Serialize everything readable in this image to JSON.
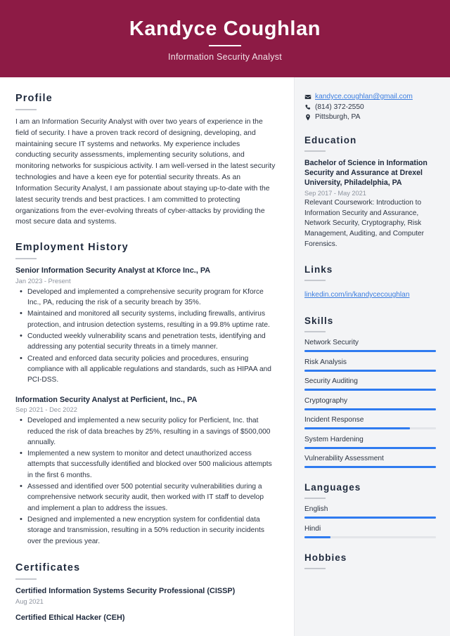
{
  "header": {
    "name": "Kandyce Coughlan",
    "job_title": "Information Security Analyst",
    "background_color": "#8d1b45"
  },
  "accent": {
    "bar_color": "#2f7bf0",
    "link_color": "#3b7de0",
    "sidebar_bg": "#f3f4f6"
  },
  "main": {
    "profile": {
      "heading": "Profile",
      "text": "I am an Information Security Analyst with over two years of experience in the field of security. I have a proven track record of designing, developing, and maintaining secure IT systems and networks. My experience includes conducting security assessments, implementing security solutions, and monitoring networks for suspicious activity. I am well-versed in the latest security technologies and have a keen eye for potential security threats. As an Information Security Analyst, I am passionate about staying up-to-date with the latest security trends and best practices. I am committed to protecting organizations from the ever-evolving threats of cyber-attacks by providing the most secure data and systems."
    },
    "employment": {
      "heading": "Employment History",
      "jobs": [
        {
          "title": "Senior Information Security Analyst at Kforce Inc., PA",
          "date": "Jan 2023 - Present",
          "bullets": [
            "Developed and implemented a comprehensive security program for Kforce Inc., PA, reducing the risk of a security breach by 35%.",
            "Maintained and monitored all security systems, including firewalls, antivirus protection, and intrusion detection systems, resulting in a 99.8% uptime rate.",
            "Conducted weekly vulnerability scans and penetration tests, identifying and addressing any potential security threats in a timely manner.",
            "Created and enforced data security policies and procedures, ensuring compliance with all applicable regulations and standards, such as HIPAA and PCI-DSS."
          ]
        },
        {
          "title": "Information Security Analyst at Perficient, Inc., PA",
          "date": "Sep 2021 - Dec 2022",
          "bullets": [
            "Developed and implemented a new security policy for Perficient, Inc. that reduced the risk of data breaches by 25%, resulting in a savings of $500,000 annually.",
            "Implemented a new system to monitor and detect unauthorized access attempts that successfully identified and blocked over 500 malicious attempts in the first 6 months.",
            "Assessed and identified over 500 potential security vulnerabilities during a comprehensive network security audit, then worked with IT staff to develop and implement a plan to address the issues.",
            "Designed and implemented a new encryption system for confidential data storage and transmission, resulting in a 50% reduction in security incidents over the previous year."
          ]
        }
      ]
    },
    "certificates": {
      "heading": "Certificates",
      "items": [
        {
          "title": "Certified Information Systems Security Professional (CISSP)",
          "date": "Aug 2021"
        },
        {
          "title": "Certified Ethical Hacker (CEH)",
          "date": ""
        }
      ]
    }
  },
  "sidebar": {
    "contact": {
      "email": "kandyce.coughlan@gmail.com",
      "phone": "(814) 372-2550",
      "location": "Pittsburgh, PA",
      "email_icon": "envelope-icon",
      "phone_icon": "phone-icon",
      "location_icon": "map-pin-icon"
    },
    "education": {
      "heading": "Education",
      "items": [
        {
          "title": "Bachelor of Science in Information Security and Assurance at Drexel University, Philadelphia, PA",
          "date": "Sep 2017 - May 2021",
          "description": "Relevant Coursework: Introduction to Information Security and Assurance, Network Security, Cryptography, Risk Management, Auditing, and Computer Forensics."
        }
      ]
    },
    "links": {
      "heading": "Links",
      "items": [
        {
          "label": "linkedin.com/in/kandycecoughlan"
        }
      ]
    },
    "skills": {
      "heading": "Skills",
      "items": [
        {
          "label": "Network Security",
          "level": 100
        },
        {
          "label": "Risk Analysis",
          "level": 100
        },
        {
          "label": "Security Auditing",
          "level": 100
        },
        {
          "label": "Cryptography",
          "level": 100
        },
        {
          "label": "Incident Response",
          "level": 80
        },
        {
          "label": "System Hardening",
          "level": 100
        },
        {
          "label": "Vulnerability Assessment",
          "level": 100
        }
      ]
    },
    "languages": {
      "heading": "Languages",
      "items": [
        {
          "label": "English",
          "level": 100
        },
        {
          "label": "Hindi",
          "level": 20
        }
      ]
    },
    "hobbies": {
      "heading": "Hobbies"
    }
  }
}
